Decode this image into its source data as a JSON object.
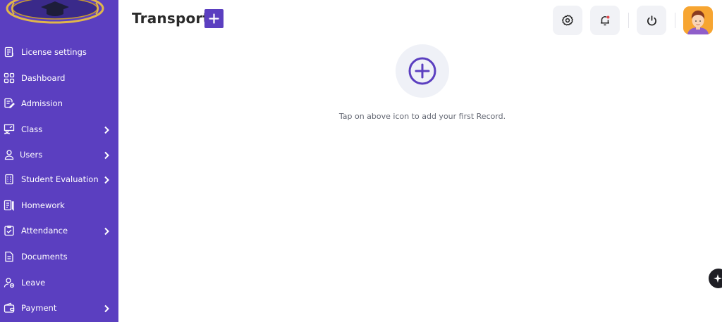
{
  "page": {
    "title": "Transport"
  },
  "sidebar": {
    "items": [
      {
        "label": "License settings",
        "icon": "license-icon",
        "has_submenu": false
      },
      {
        "label": "Dashboard",
        "icon": "dashboard-grid-icon",
        "has_submenu": false
      },
      {
        "label": "Admission",
        "icon": "admission-icon",
        "has_submenu": false
      },
      {
        "label": "Class",
        "icon": "class-icon",
        "has_submenu": true
      },
      {
        "label": "Users",
        "icon": "user-icon",
        "has_submenu": true
      },
      {
        "label": "Student Evaluation",
        "icon": "evaluation-icon",
        "has_submenu": true
      },
      {
        "label": "Homework",
        "icon": "homework-icon",
        "has_submenu": false
      },
      {
        "label": "Attendance",
        "icon": "attendance-icon",
        "has_submenu": true
      },
      {
        "label": "Documents",
        "icon": "documents-icon",
        "has_submenu": false
      },
      {
        "label": "Leave",
        "icon": "leave-icon",
        "has_submenu": false
      },
      {
        "label": "Payment",
        "icon": "wallet-icon",
        "has_submenu": true
      }
    ]
  },
  "header": {
    "buttons": [
      "gear-icon",
      "bell-icon",
      "power-icon"
    ],
    "notification_dot_color": "#e5484d"
  },
  "empty_state": {
    "message": "Tap on above icon to add your first Record.",
    "icon": "plus-circle-icon"
  },
  "colors": {
    "brand": "#5b3fc0",
    "header_button_bg": "#f1f2f6",
    "avatar_bg": "#f7a531"
  }
}
